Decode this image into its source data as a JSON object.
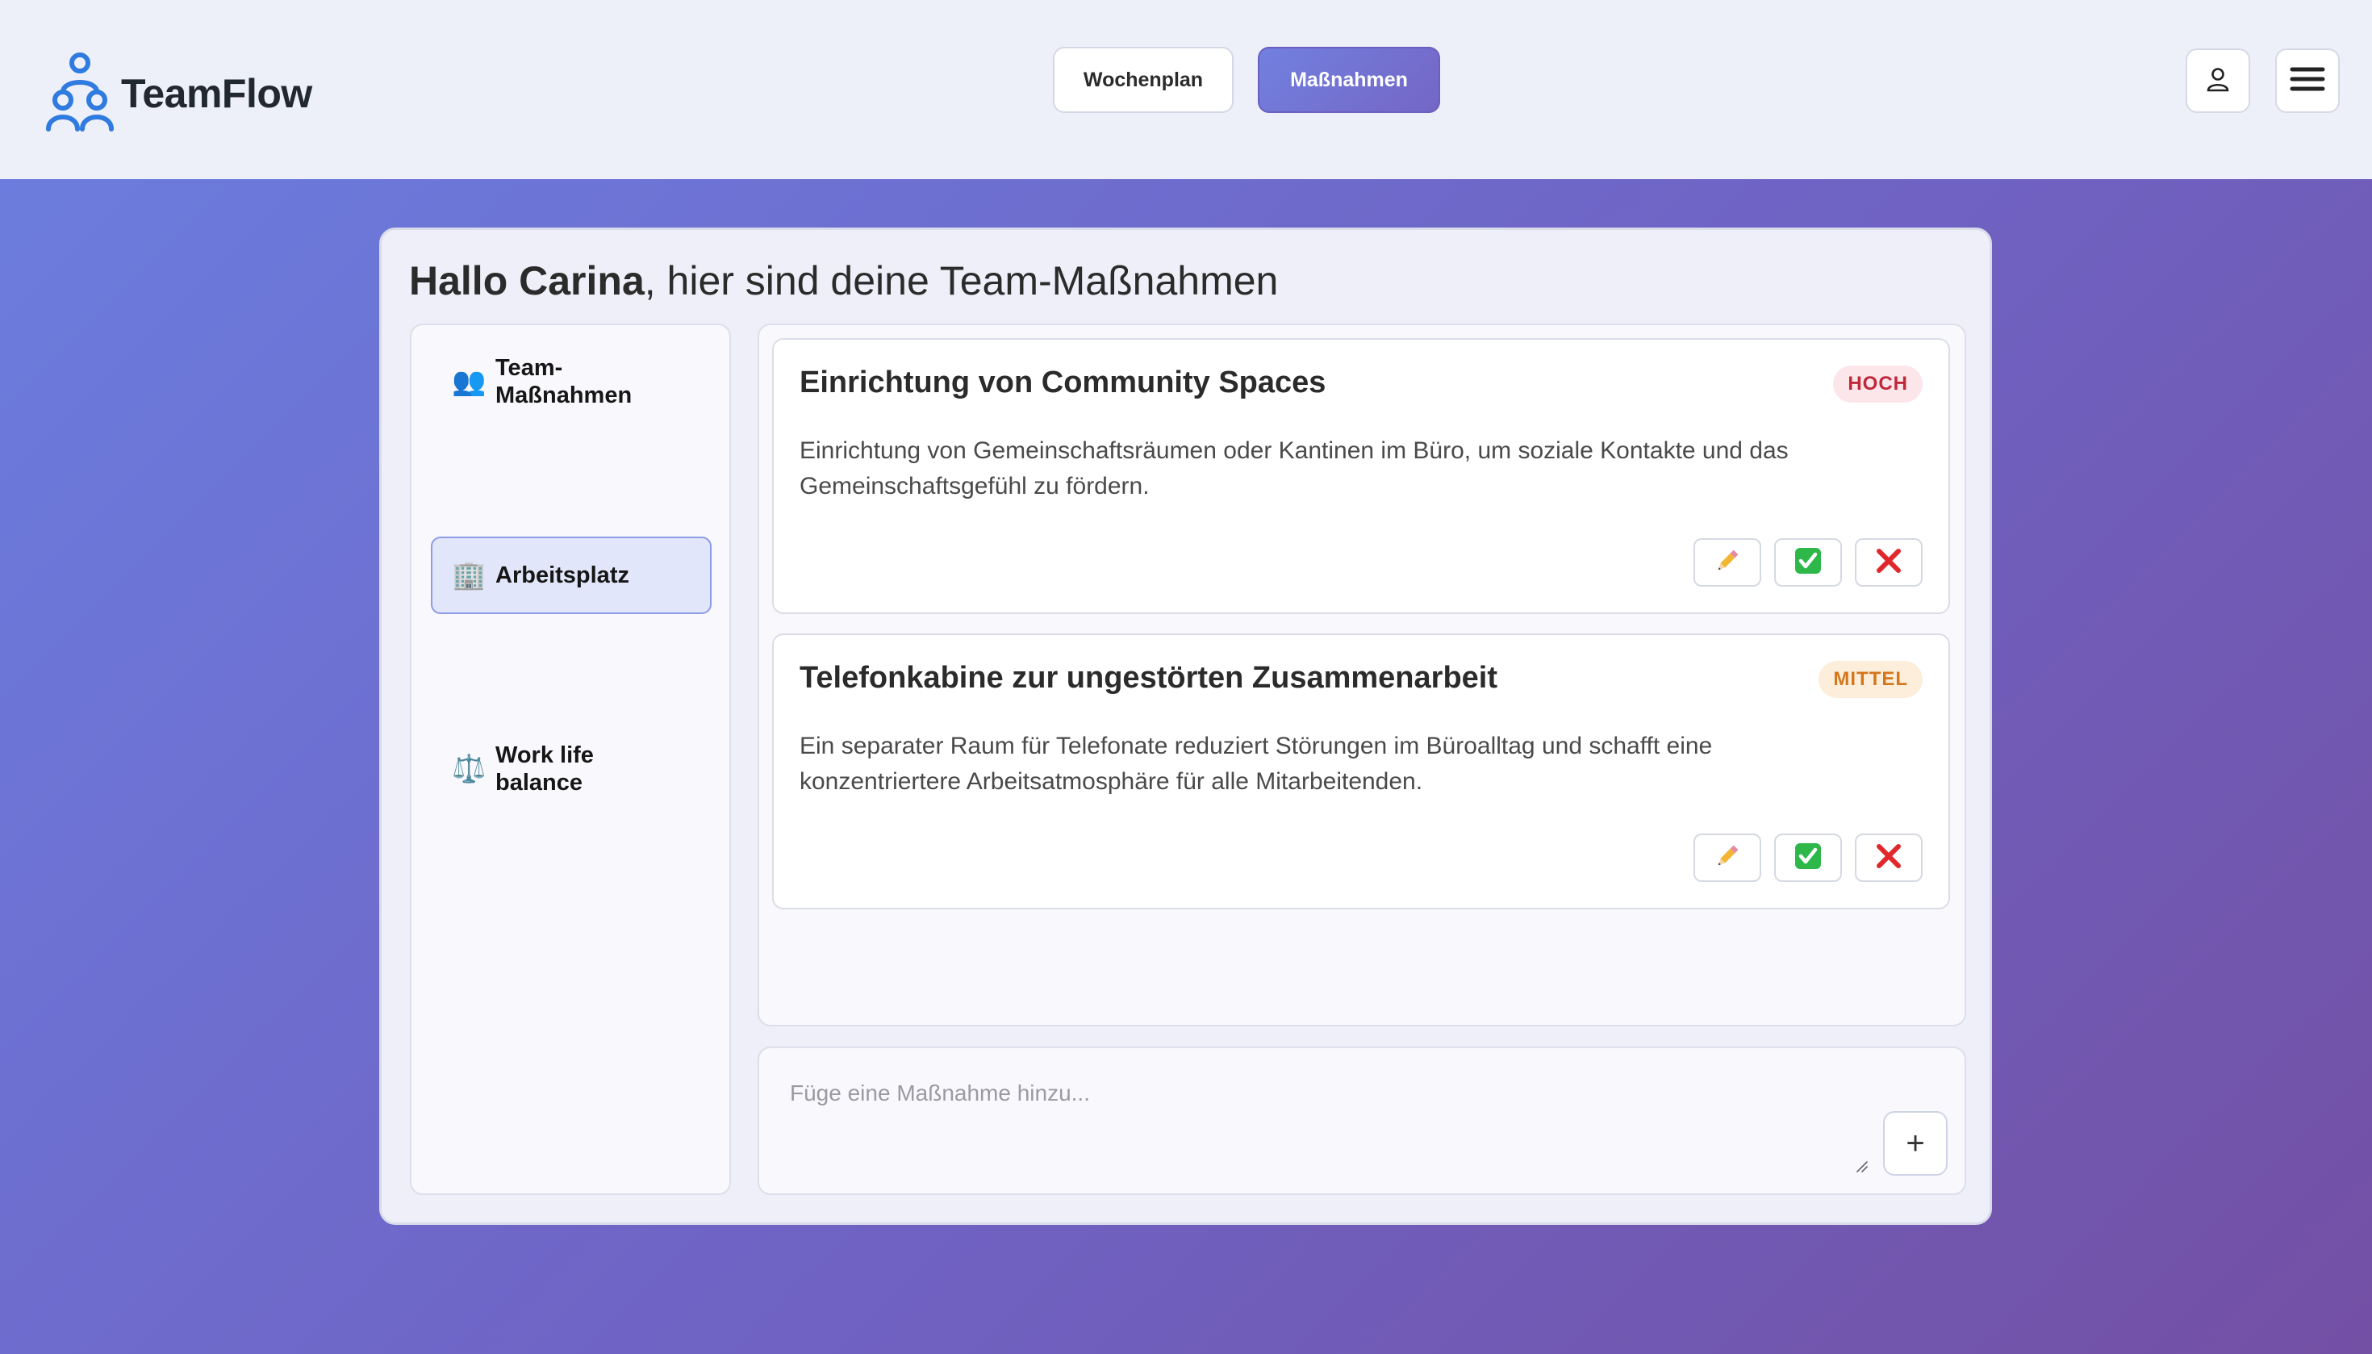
{
  "app": {
    "name": "TeamFlow"
  },
  "header": {
    "nav": [
      {
        "label": "Wochenplan",
        "active": false
      },
      {
        "label": "Maßnahmen",
        "active": true
      }
    ],
    "icons": {
      "logo": "team-logo-icon",
      "user": "user-icon",
      "menu": "hamburger-menu-icon"
    }
  },
  "main": {
    "greeting_name": "Hallo Carina",
    "greeting_rest": ", hier sind deine Team-Maßnahmen",
    "sidebar": {
      "items": [
        {
          "icon": "👥",
          "icon_name": "people-icon",
          "label": "Team-Maßnahmen",
          "selected": false
        },
        {
          "icon": "🏢",
          "icon_name": "office-building-icon",
          "label": "Arbeitsplatz",
          "selected": true
        },
        {
          "icon": "⚖️",
          "icon_name": "balance-scale-icon",
          "label": "Work life balance",
          "selected": false
        }
      ]
    },
    "measures": [
      {
        "title": "Einrichtung von Community Spaces",
        "priority": "HOCH",
        "priority_color": "#c0283a",
        "description": "Einrichtung von Gemeinschaftsräumen oder Kantinen im Büro, um soziale Kontakte und das Gemeinschaftsgefühl zu fördern."
      },
      {
        "title": "Telefonkabine zur ungestörten Zusammenarbeit",
        "priority": "MITTEL",
        "priority_color": "#d4761c",
        "description": "Ein separater Raum für Telefonate reduziert Störungen im Büroalltag und schafft eine konzentriertere Arbeitsatmosphäre für alle Mitarbeitenden."
      }
    ],
    "actions": {
      "edit_icon": "pencil-icon",
      "accept_icon": "check-icon",
      "reject_icon": "cross-icon"
    },
    "add": {
      "placeholder": "Füge eine Maßnahme hinzu...",
      "button_label": "+"
    }
  },
  "colors": {
    "accent": "#7280df",
    "background_gradient_start": "#6b7fe0",
    "background_gradient_end": "#7350a4"
  }
}
